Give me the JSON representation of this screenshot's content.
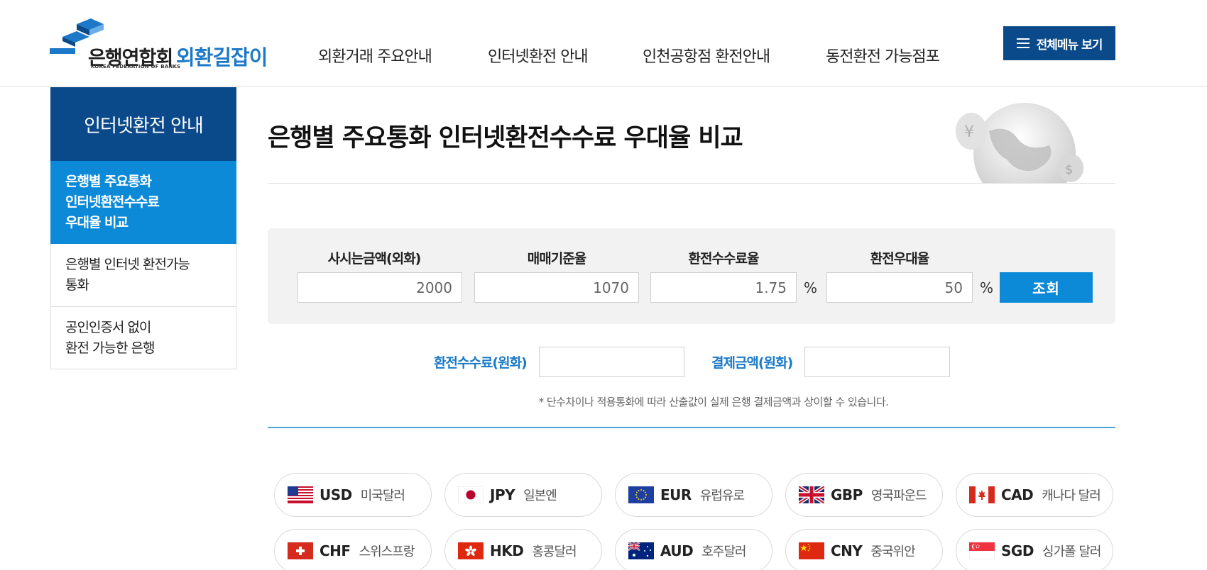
{
  "header": {
    "logo_text": "은행연합회",
    "logo_sub": "KOREA FEDERATION OF BANKS",
    "logo_brand": "외환길잡이",
    "nav": [
      "외환거래 주요안내",
      "인터넷환전 안내",
      "인천공항점 환전안내",
      "동전환전 가능점포"
    ],
    "all_menu_label": "전체메뉴 보기"
  },
  "sidebar": {
    "title": "인터넷환전 안내",
    "items": [
      {
        "label": "은행별 주요통화\n인터넷환전수수료\n우대율 비교",
        "active": true
      },
      {
        "label": "은행별 인터넷 환전가능\n통화",
        "active": false
      },
      {
        "label": "공인인증서 없이\n환전 가능한 은행",
        "active": false
      }
    ]
  },
  "main": {
    "title": "은행별 주요통화 인터넷환전수수료 우대율 비교",
    "calc": {
      "amount_label": "사시는금액(외화)",
      "amount_value": "2000",
      "rate_label": "매매기준율",
      "rate_value": "1070",
      "fee_label": "환전수수료율",
      "fee_value": "1.75",
      "fee_unit": "%",
      "discount_label": "환전우대율",
      "discount_value": "50",
      "discount_unit": "%",
      "search_label": "조회"
    },
    "result": {
      "fee_label": "환전수수료(원화)",
      "pay_label": "결제금액(원화)"
    },
    "note": "* 단수차이나 적용통화에 따라 산출값이 실제 은행 결제금액과 상이할 수 있습니다."
  },
  "currencies": [
    {
      "code": "USD",
      "name": "미국달러",
      "flag": "us-flag-icon"
    },
    {
      "code": "JPY",
      "name": "일본엔",
      "flag": "jp-flag-icon"
    },
    {
      "code": "EUR",
      "name": "유럽유로",
      "flag": "eu-flag-icon"
    },
    {
      "code": "GBP",
      "name": "영국파운드",
      "flag": "gb-flag-icon"
    },
    {
      "code": "CAD",
      "name": "캐나다 달러",
      "flag": "ca-flag-icon"
    },
    {
      "code": "CHF",
      "name": "스위스프랑",
      "flag": "ch-flag-icon"
    },
    {
      "code": "HKD",
      "name": "홍콩달러",
      "flag": "hk-flag-icon"
    },
    {
      "code": "AUD",
      "name": "호주달러",
      "flag": "au-flag-icon"
    },
    {
      "code": "CNY",
      "name": "중국위안",
      "flag": "cn-flag-icon"
    },
    {
      "code": "SGD",
      "name": "싱가폴 달러",
      "flag": "sg-flag-icon"
    }
  ],
  "colors": {
    "navy": "#0b4a8a",
    "blue": "#0c8ad8",
    "link_blue": "#1a7ac8"
  }
}
